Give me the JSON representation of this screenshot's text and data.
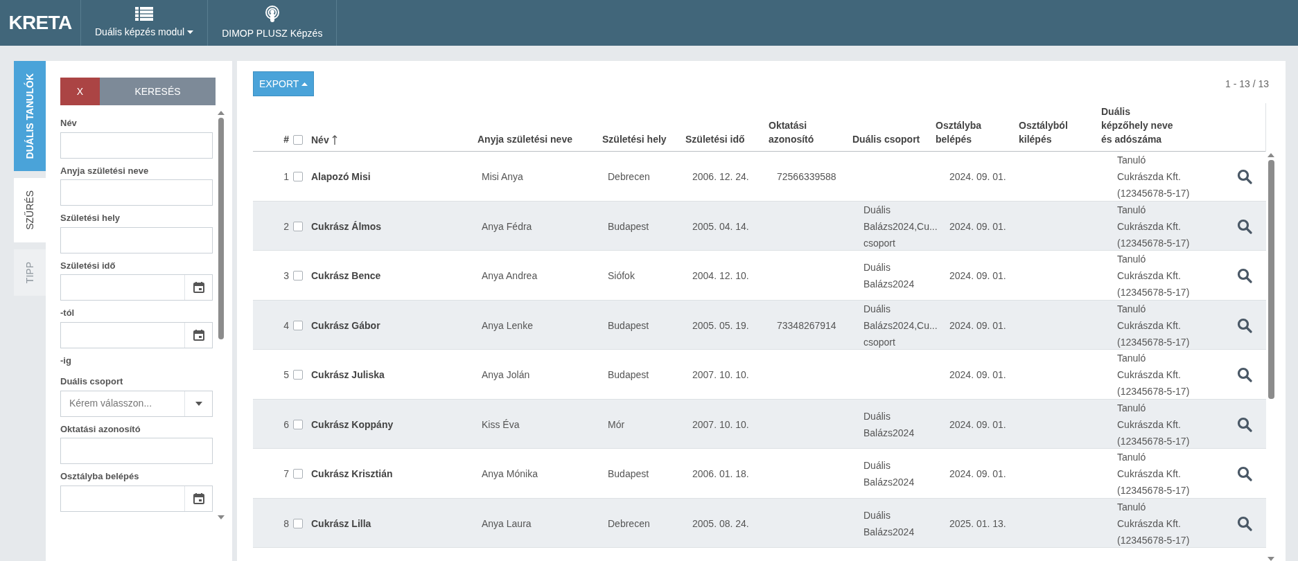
{
  "topbar": {
    "logo": "KRETA",
    "menu": [
      {
        "label": "Duális képzés modul",
        "dropdown": true
      },
      {
        "label": "DIMOP PLUSZ Képzés",
        "dropdown": false
      }
    ]
  },
  "side_tabs": [
    {
      "label": "DUÁLIS TANULÓK",
      "selected": true,
      "disabled": false
    },
    {
      "label": "SZŰRÉS",
      "selected": false,
      "disabled": false
    },
    {
      "label": "TIPP",
      "selected": false,
      "disabled": true
    }
  ],
  "filter": {
    "clear_button": "X",
    "search_button": "KERESÉS",
    "items": [
      {
        "kind": "label",
        "text": "Név"
      },
      {
        "kind": "text"
      },
      {
        "kind": "label",
        "text": "Anyja születési neve"
      },
      {
        "kind": "text"
      },
      {
        "kind": "label",
        "text": "Születési hely"
      },
      {
        "kind": "text"
      },
      {
        "kind": "label",
        "text": "Születési idő"
      },
      {
        "kind": "date"
      },
      {
        "kind": "label",
        "text": "-tól"
      },
      {
        "kind": "date"
      },
      {
        "kind": "label",
        "text": "-ig"
      },
      {
        "kind": "label",
        "text": "Duális csoport"
      },
      {
        "kind": "select",
        "placeholder": "Kérem válasszon..."
      },
      {
        "kind": "label",
        "text": "Oktatási azonosító"
      },
      {
        "kind": "text"
      },
      {
        "kind": "label",
        "text": "Osztályba belépés"
      },
      {
        "kind": "date"
      }
    ]
  },
  "toolbar": {
    "export_button": "EXPORT",
    "pager": "1 - 13 / 13"
  },
  "table": {
    "header_checked": false,
    "columns": [
      {
        "label": [
          "#"
        ]
      },
      {
        "label": [
          "Név"
        ]
      },
      {
        "label": [
          "Anyja születési neve"
        ]
      },
      {
        "label": [
          "Születési hely"
        ]
      },
      {
        "label": [
          "Születési idő"
        ]
      },
      {
        "label": [
          "Oktatási",
          "azonosító"
        ]
      },
      {
        "label": [
          "Duális csoport"
        ]
      },
      {
        "label": [
          "Osztályba",
          "belépés"
        ]
      },
      {
        "label": [
          "Osztályból",
          "kilépés"
        ]
      },
      {
        "label": [
          "Duális",
          "képzőhely neve",
          "és adószáma"
        ]
      }
    ],
    "rows": [
      {
        "num": "1",
        "checked": false,
        "name": "Alapozó Misi",
        "mother": "Misi Anya",
        "place": "Debrecen",
        "birth": "2006. 12. 24.",
        "edu_id": "72566339588",
        "group": [],
        "entry": "2024. 09. 01.",
        "exit": "",
        "company": [
          "Tanuló",
          "Cukrászda Kft.",
          "(12345678-5-17)"
        ]
      },
      {
        "num": "2",
        "checked": false,
        "name": "Cukrász Álmos",
        "mother": "Anya Fédra",
        "place": "Budapest",
        "birth": "2005. 04. 14.",
        "edu_id": "",
        "group": [
          "Duális",
          "Balázs2024,Cu...",
          "csoport"
        ],
        "entry": "2024. 09. 01.",
        "exit": "",
        "company": [
          "Tanuló",
          "Cukrászda Kft.",
          "(12345678-5-17)"
        ]
      },
      {
        "num": "3",
        "checked": false,
        "name": "Cukrász Bence",
        "mother": "Anya Andrea",
        "place": "Siófok",
        "birth": "2004. 12. 10.",
        "edu_id": "",
        "group": [
          "Duális",
          "Balázs2024"
        ],
        "entry": "2024. 09. 01.",
        "exit": "",
        "company": [
          "Tanuló",
          "Cukrászda Kft.",
          "(12345678-5-17)"
        ]
      },
      {
        "num": "4",
        "checked": false,
        "name": "Cukrász Gábor",
        "mother": "Anya Lenke",
        "place": "Budapest",
        "birth": "2005. 05. 19.",
        "edu_id": "73348267914",
        "group": [
          "Duális",
          "Balázs2024,Cu...",
          "csoport"
        ],
        "entry": "2024. 09. 01.",
        "exit": "",
        "company": [
          "Tanuló",
          "Cukrászda Kft.",
          "(12345678-5-17)"
        ]
      },
      {
        "num": "5",
        "checked": false,
        "name": "Cukrász Juliska",
        "mother": "Anya Jolán",
        "place": "Budapest",
        "birth": "2007. 10. 10.",
        "edu_id": "",
        "group": [],
        "entry": "2024. 09. 01.",
        "exit": "",
        "company": [
          "Tanuló",
          "Cukrászda Kft.",
          "(12345678-5-17)"
        ]
      },
      {
        "num": "6",
        "checked": false,
        "name": "Cukrász Koppány",
        "mother": "Kiss Éva",
        "place": "Mór",
        "birth": "2007. 10. 10.",
        "edu_id": "",
        "group": [
          "Duális",
          "Balázs2024"
        ],
        "entry": "2024. 09. 01.",
        "exit": "",
        "company": [
          "Tanuló",
          "Cukrászda Kft.",
          "(12345678-5-17)"
        ]
      },
      {
        "num": "7",
        "checked": false,
        "name": "Cukrász Krisztián",
        "mother": "Anya Mónika",
        "place": "Budapest",
        "birth": "2006. 01. 18.",
        "edu_id": "",
        "group": [
          "Duális",
          "Balázs2024"
        ],
        "entry": "2024. 09. 01.",
        "exit": "",
        "company": [
          "Tanuló",
          "Cukrászda Kft.",
          "(12345678-5-17)"
        ]
      },
      {
        "num": "8",
        "checked": false,
        "name": "Cukrász Lilla",
        "mother": "Anya Laura",
        "place": "Debrecen",
        "birth": "2005. 08. 24.",
        "edu_id": "",
        "group": [
          "Duális",
          "Balázs2024"
        ],
        "entry": "2025. 01. 13.",
        "exit": "",
        "company": [
          "Tanuló",
          "Cukrászda Kft.",
          "(12345678-5-17)"
        ]
      }
    ]
  }
}
